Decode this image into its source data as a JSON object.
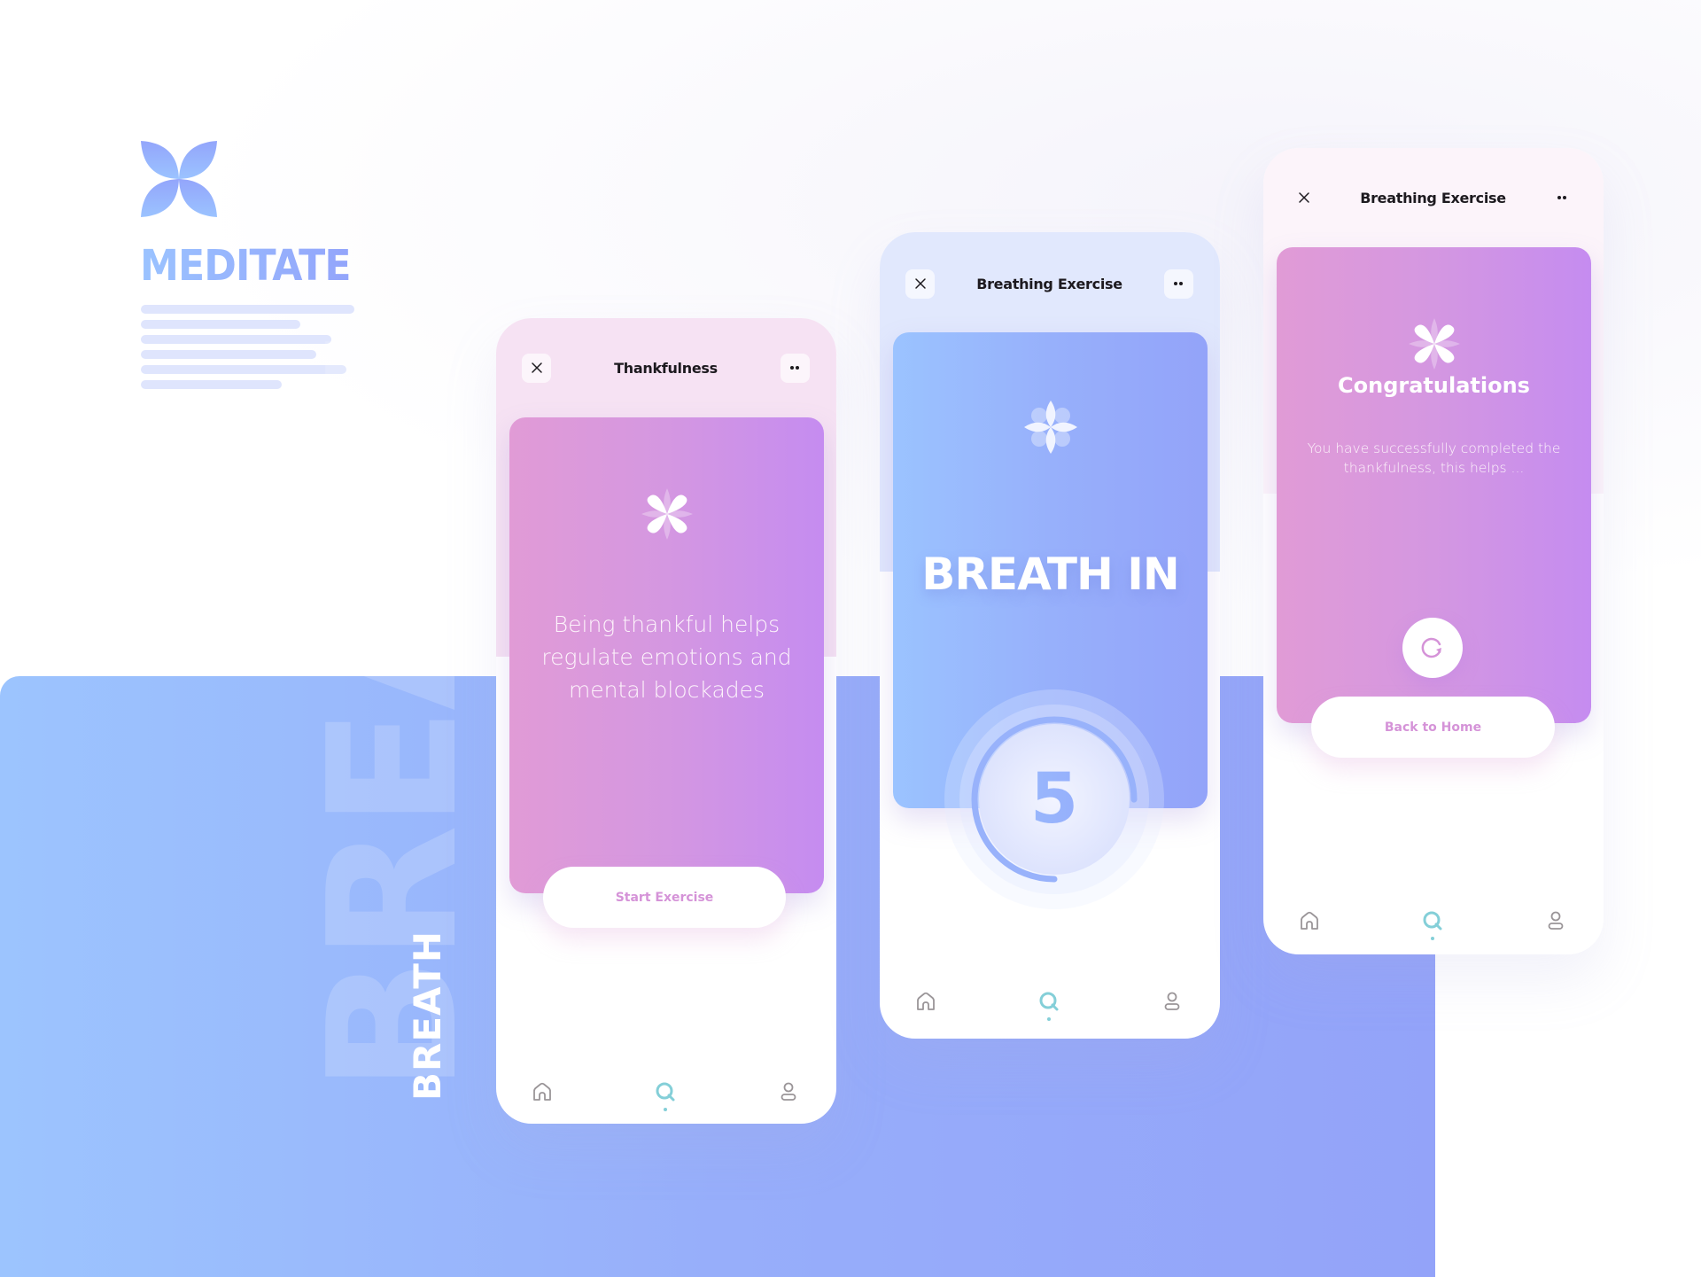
{
  "brand": {
    "logo_icon": "four-petal-flower-icon",
    "title": "MEDITATE",
    "placeholder_lines": 6,
    "colors": {
      "gradient_start": "#9bc3ff",
      "gradient_end": "#93a3f9",
      "line": "#dfe5fd"
    }
  },
  "stage": {
    "watermark_text": "BREATH",
    "vertical_label": "BREATH",
    "colors": {
      "left": "#9cc4fe",
      "right": "#93a3f9"
    }
  },
  "screens": [
    {
      "id": "thankfulness",
      "header": {
        "close_icon": "close-icon",
        "title": "Thankfulness",
        "menu_icon": "more-dots-icon"
      },
      "card": {
        "icon": "flower-icon",
        "text_lines": [
          "Being thankful helps",
          "regulate emotions and",
          "mental blockades"
        ]
      },
      "primary_button": "Start Exercise",
      "nav": {
        "items": [
          "home",
          "search",
          "profile"
        ],
        "active": "search"
      }
    },
    {
      "id": "breathing-exercise",
      "header": {
        "close_icon": "close-icon",
        "title": "Breathing Exercise",
        "menu_icon": "more-dots-icon"
      },
      "card": {
        "icon": "flower-icon",
        "instruction": "BREATH IN"
      },
      "countdown": {
        "value": "5",
        "progress": 0.75
      },
      "nav": {
        "items": [
          "home",
          "search",
          "profile"
        ],
        "active": "search"
      }
    },
    {
      "id": "congratulations",
      "header": {
        "close_icon": "close-icon",
        "title": "Breathing Exercise",
        "menu_icon": "more-dots-icon"
      },
      "card": {
        "icon": "flower-icon",
        "title": "Congratulations",
        "text_lines": [
          "You have successfully completed the",
          "thankfulness, this helps ..."
        ],
        "action_icon": "replay-icon"
      },
      "primary_button": "Back to Home",
      "nav": {
        "items": [
          "home",
          "search",
          "profile"
        ],
        "active": "search"
      }
    }
  ],
  "colors": {
    "pink_tint": "#f6e2f3",
    "blue_tint": "#e1e8fd",
    "light_tint": "#fcf4fa",
    "card_pink_start": "#e19bd6",
    "card_pink_end": "#c58cf0",
    "card_blue_start": "#9bc3ff",
    "card_blue_end": "#93a3f9",
    "button_text": "#d593d8",
    "nav_active": "#84cfd8",
    "nav_inactive": "#9a9598",
    "header_text": "#1d1a1f"
  }
}
